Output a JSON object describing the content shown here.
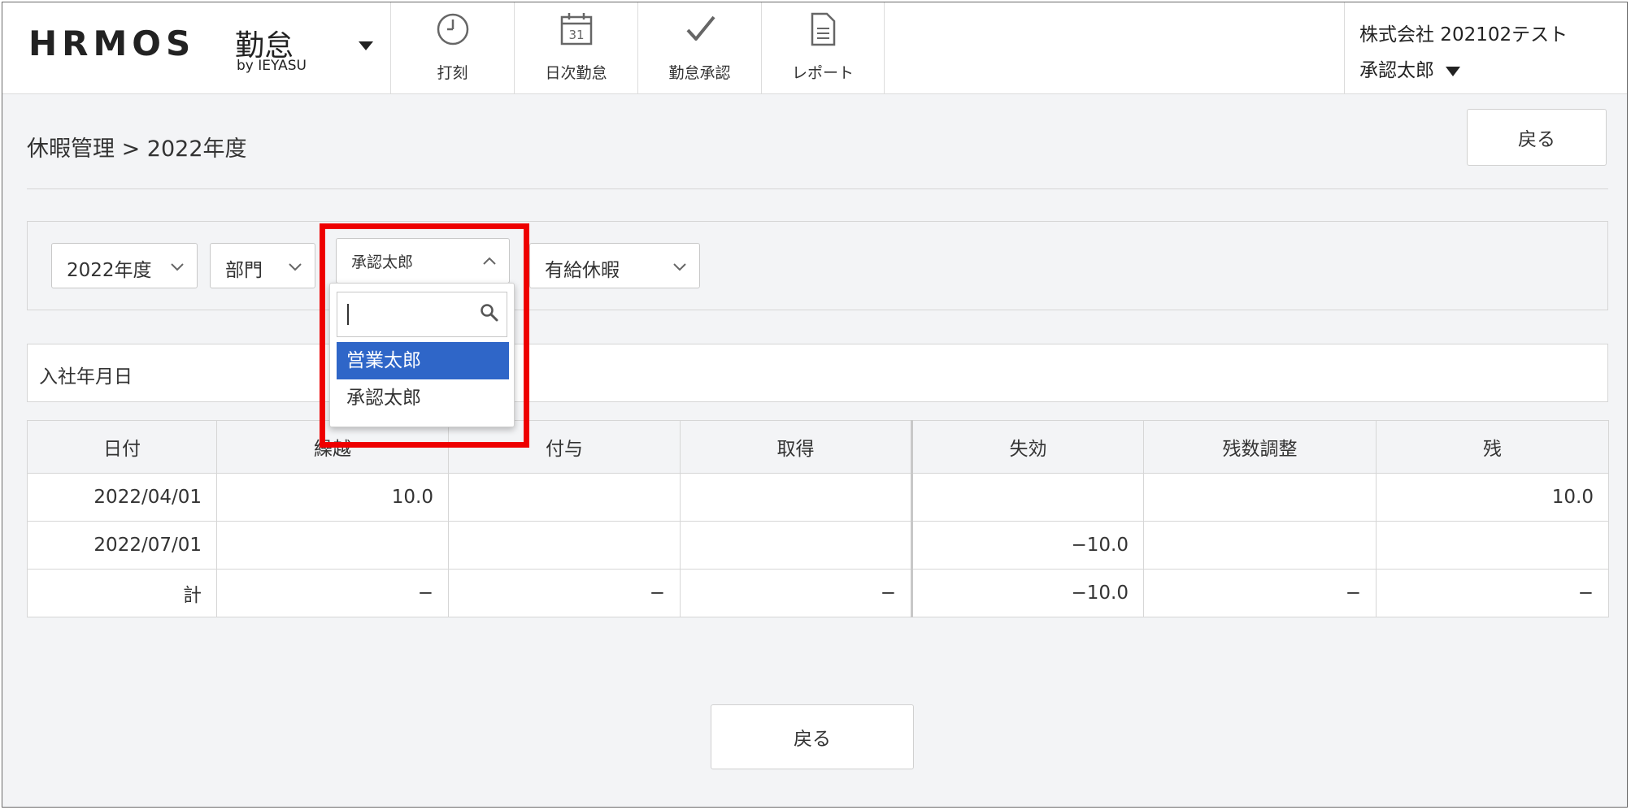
{
  "header": {
    "logo": {
      "wordmark": "HRMOS",
      "product": "勤怠",
      "byline": "by IEYASU"
    },
    "nav": [
      {
        "label": "打刻",
        "icon": "clock-icon"
      },
      {
        "label": "日次勤怠",
        "icon": "calendar-icon",
        "icon_text": "31"
      },
      {
        "label": "勤怠承認",
        "icon": "checkmark-icon"
      },
      {
        "label": "レポート",
        "icon": "document-icon"
      }
    ],
    "account": {
      "company": "株式会社 202102テスト",
      "user": "承認太郎"
    }
  },
  "page": {
    "breadcrumb": "休暇管理 > 2022年度",
    "back_label": "戻る"
  },
  "filters": {
    "year": "2022年度",
    "department": "部門",
    "employee": "承認太郎",
    "leave_type": "有給休暇"
  },
  "dropdown": {
    "search_value": "",
    "options": [
      "営業太郎",
      "承認太郎"
    ],
    "highlighted": "営業太郎"
  },
  "join_date": {
    "label": "入社年月日",
    "value": ""
  },
  "table": {
    "headers": [
      "日付",
      "繰越",
      "付与",
      "取得",
      "失効",
      "残数調整",
      "残"
    ],
    "rows": [
      [
        "2022/04/01",
        "10.0",
        "",
        "",
        "",
        "",
        "10.0"
      ],
      [
        "2022/07/01",
        "",
        "",
        "",
        "−10.0",
        "",
        ""
      ],
      [
        "計",
        "−",
        "−",
        "−",
        "−10.0",
        "−",
        "−"
      ]
    ]
  },
  "colors": {
    "highlight_border": "#ee0000",
    "selected_option": "#2f66c8",
    "page_background": "#f3f4f6"
  }
}
